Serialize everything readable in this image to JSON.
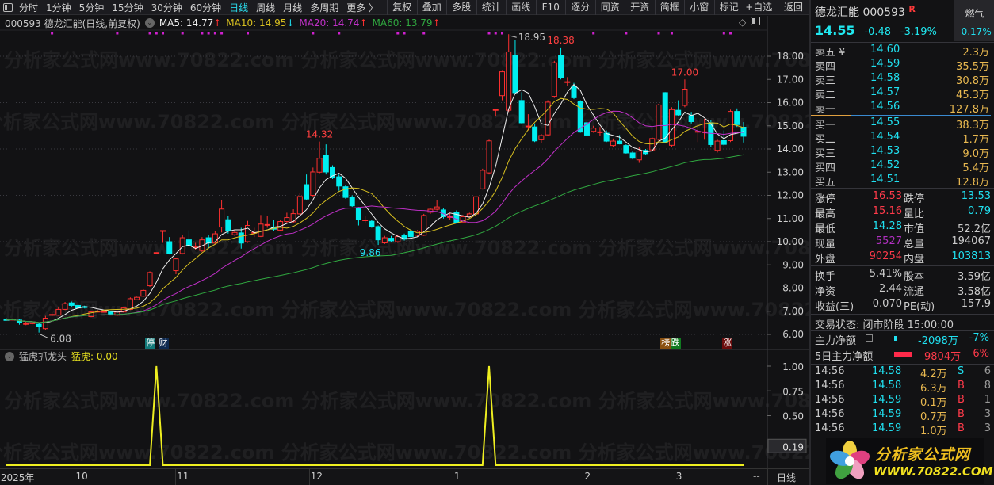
{
  "toolbar": {
    "periods": [
      "分时",
      "1分钟",
      "5分钟",
      "15分钟",
      "30分钟",
      "60分钟",
      "日线",
      "周线",
      "月线",
      "多周期",
      "更多 〉"
    ],
    "active_period": "日线",
    "buttons": [
      "复权",
      "叠加",
      "多股",
      "统计",
      "画线",
      "F10",
      "逐分",
      "同资",
      "开资",
      "简框",
      "小窗",
      "标记",
      "+自选"
    ],
    "back": "返回"
  },
  "header": {
    "title": "000593 德龙汇能(日线,前复权)",
    "ma5": "MA5: 14.77",
    "ma5_arrow": "↑",
    "ma10": "MA10: 14.95",
    "ma10_arrow": "↓",
    "ma20": "MA20: 14.74",
    "ma20_arrow": "↑",
    "ma60": "MA60: 13.79",
    "ma60_arrow": "↑",
    "diamond": "◇"
  },
  "watermark": "分析家公式网www.70822.com",
  "badges": [
    {
      "text": "停",
      "bg": "#137a7a",
      "at_index": 22
    },
    {
      "text": "财",
      "bg": "#0f2a50",
      "at_index": 24
    },
    {
      "text": "榜",
      "bg": "#8a5010",
      "at_index": 101
    },
    {
      "text": "跌",
      "bg": "#107a20",
      "at_index": 102.5
    },
    {
      "text": "涨",
      "bg": "#6a0c0c",
      "at_index": 110.5
    }
  ],
  "indicator": {
    "name": "猛虎抓龙头",
    "series_label": "猛虎:",
    "value": "0.00"
  },
  "colors": {
    "up": "#ff3030",
    "down": "#00eef0",
    "ma5": "#f0f0f0",
    "ma10": "#d8c020",
    "ma20": "#c030c8",
    "ma60": "#30a840",
    "indicator": "#eeee20",
    "marker": "#d020d0"
  },
  "chart_data": [
    {
      "type": "candlestick",
      "title": "000593 德龙汇能(日线,前复权)",
      "ylim": [
        6,
        18
      ],
      "yticks": [
        "18.00",
        "17.00",
        "16.00",
        "15.00",
        "14.00",
        "13.00",
        "12.00",
        "11.00",
        "10.00",
        "9.00",
        "8.00",
        "7.00",
        "6.00"
      ],
      "ma_periods": [
        5,
        10,
        20,
        60
      ],
      "ohlc": [
        [
          6.64,
          6.7,
          6.58,
          6.62
        ],
        [
          6.62,
          6.7,
          6.6,
          6.66
        ],
        [
          6.62,
          6.66,
          6.42,
          6.5
        ],
        [
          6.47,
          6.55,
          6.4,
          6.47
        ],
        [
          6.5,
          6.56,
          6.44,
          6.5
        ],
        [
          6.44,
          6.48,
          6.08,
          6.33
        ],
        [
          6.25,
          6.8,
          6.2,
          6.7
        ],
        [
          6.86,
          6.96,
          6.78,
          6.86
        ],
        [
          6.83,
          7.2,
          6.8,
          7.08
        ],
        [
          7.08,
          7.4,
          7.05,
          7.33
        ],
        [
          7.36,
          7.42,
          7.2,
          7.25
        ],
        [
          7.25,
          7.3,
          7.1,
          7.14
        ],
        [
          7.2,
          7.24,
          7.12,
          7.16
        ],
        [
          6.77,
          7.0,
          6.74,
          6.97
        ],
        [
          7.0,
          7.05,
          6.95,
          7.0
        ],
        [
          6.99,
          7.04,
          6.95,
          6.99
        ],
        [
          6.97,
          7.0,
          6.85,
          6.88
        ],
        [
          6.83,
          7.0,
          6.8,
          6.97
        ],
        [
          6.97,
          7.18,
          6.94,
          7.14
        ],
        [
          7.08,
          7.6,
          7.05,
          7.54
        ],
        [
          7.5,
          7.63,
          7.47,
          7.6
        ],
        [
          7.65,
          7.95,
          7.62,
          7.9
        ],
        [
          8.1,
          8.72,
          8.05,
          8.67
        ],
        [
          9.53,
          9.53,
          9.5,
          9.53
        ],
        [
          10.48,
          10.48,
          9.95,
          10.48
        ],
        [
          10.0,
          10.2,
          9.45,
          9.5
        ],
        [
          8.75,
          9.3,
          8.6,
          9.26
        ],
        [
          9.49,
          10.3,
          9.45,
          10.17
        ],
        [
          10.08,
          10.5,
          9.8,
          9.83
        ],
        [
          9.77,
          9.95,
          9.65,
          9.77
        ],
        [
          9.62,
          10.2,
          9.55,
          10.08
        ],
        [
          10.17,
          10.3,
          9.7,
          9.94
        ],
        [
          9.94,
          10.45,
          9.9,
          10.34
        ],
        [
          10.63,
          11.8,
          10.4,
          11.41
        ],
        [
          10.95,
          11.1,
          10.35,
          10.47
        ],
        [
          10.3,
          10.5,
          10.25,
          10.4
        ],
        [
          10.38,
          10.6,
          9.7,
          9.94
        ],
        [
          10.0,
          10.9,
          9.95,
          10.7
        ],
        [
          10.4,
          10.6,
          10.2,
          10.4
        ],
        [
          10.23,
          11.15,
          10.2,
          10.76
        ],
        [
          10.74,
          11.1,
          10.6,
          10.74
        ],
        [
          10.63,
          10.95,
          10.45,
          10.54
        ],
        [
          10.5,
          10.95,
          10.45,
          10.87
        ],
        [
          10.87,
          11.25,
          10.8,
          11.04
        ],
        [
          10.86,
          11.4,
          10.8,
          11.21
        ],
        [
          11.2,
          12.1,
          11.15,
          11.95
        ],
        [
          12.46,
          12.9,
          11.8,
          11.84
        ],
        [
          12.0,
          13.2,
          11.95,
          13.01
        ],
        [
          13.0,
          14.32,
          12.95,
          13.6
        ],
        [
          13.74,
          14.2,
          12.9,
          13.01
        ],
        [
          13.2,
          13.3,
          12.7,
          12.75
        ],
        [
          12.8,
          12.9,
          12.2,
          12.4
        ],
        [
          12.37,
          12.45,
          11.85,
          11.91
        ],
        [
          11.91,
          12.0,
          11.5,
          11.55
        ],
        [
          11.45,
          11.5,
          10.7,
          10.94
        ],
        [
          10.94,
          11.1,
          10.8,
          10.94
        ],
        [
          10.88,
          10.95,
          10.6,
          10.65
        ],
        [
          10.65,
          10.7,
          9.86,
          10.08
        ],
        [
          9.95,
          10.25,
          9.9,
          10.17
        ],
        [
          10.15,
          10.25,
          10.0,
          10.04
        ],
        [
          10.0,
          10.3,
          9.95,
          10.22
        ],
        [
          10.28,
          10.35,
          10.05,
          10.11
        ],
        [
          10.45,
          10.55,
          10.15,
          10.22
        ],
        [
          10.28,
          10.5,
          10.2,
          10.45
        ],
        [
          10.28,
          11.2,
          10.25,
          11.13
        ],
        [
          11.27,
          11.45,
          11.2,
          11.4
        ],
        [
          11.4,
          11.8,
          11.35,
          11.5
        ],
        [
          11.37,
          11.45,
          11.0,
          11.08
        ],
        [
          11.08,
          11.25,
          10.95,
          11.08
        ],
        [
          11.28,
          11.35,
          10.8,
          10.83
        ],
        [
          10.83,
          11.15,
          10.8,
          11.08
        ],
        [
          11.08,
          11.25,
          11.05,
          11.2
        ],
        [
          11.2,
          12.0,
          11.15,
          11.94
        ],
        [
          12.28,
          13.15,
          12.25,
          13.08
        ],
        [
          12.97,
          14.4,
          12.9,
          14.35
        ],
        [
          15.7,
          15.7,
          15.4,
          15.7
        ],
        [
          16.3,
          17.4,
          16.1,
          17.33
        ],
        [
          15.67,
          18.95,
          15.6,
          18.19
        ],
        [
          18.02,
          18.7,
          16.4,
          16.43
        ],
        [
          16.09,
          16.45,
          15.1,
          15.13
        ],
        [
          14.99,
          15.5,
          14.8,
          14.99
        ],
        [
          14.95,
          15.1,
          14.3,
          14.35
        ],
        [
          14.4,
          14.65,
          14.25,
          14.58
        ],
        [
          14.61,
          16.1,
          14.55,
          16.02
        ],
        [
          16.27,
          17.8,
          16.2,
          17.72
        ],
        [
          18.04,
          18.38,
          17.0,
          17.07
        ],
        [
          16.9,
          17.1,
          16.7,
          16.9
        ],
        [
          16.72,
          16.85,
          16.15,
          16.21
        ],
        [
          16.04,
          16.1,
          14.7,
          14.73
        ],
        [
          15.13,
          15.2,
          14.55,
          14.6
        ],
        [
          14.76,
          15.0,
          14.7,
          14.9
        ],
        [
          14.74,
          14.95,
          14.55,
          14.74
        ],
        [
          14.68,
          14.8,
          14.3,
          14.34
        ],
        [
          14.15,
          14.45,
          14.1,
          14.34
        ],
        [
          14.34,
          14.6,
          14.2,
          14.22
        ],
        [
          14.15,
          14.2,
          13.8,
          13.83
        ],
        [
          13.83,
          13.9,
          13.55,
          13.6
        ],
        [
          13.53,
          14.1,
          13.4,
          13.91
        ],
        [
          13.94,
          14.0,
          13.75,
          13.8
        ],
        [
          13.96,
          14.5,
          13.9,
          14.45
        ],
        [
          14.42,
          15.95,
          14.35,
          15.9
        ],
        [
          16.43,
          16.45,
          14.25,
          14.3
        ],
        [
          14.16,
          15.8,
          14.1,
          15.7
        ],
        [
          15.67,
          16.1,
          15.4,
          15.47
        ],
        [
          15.88,
          17.0,
          15.8,
          16.58
        ],
        [
          15.44,
          15.6,
          15.1,
          15.18
        ],
        [
          14.76,
          15.1,
          14.3,
          14.76
        ],
        [
          14.74,
          15.3,
          14.4,
          14.74
        ],
        [
          15.13,
          15.25,
          14.1,
          14.19
        ],
        [
          13.94,
          14.4,
          13.85,
          14.34
        ],
        [
          14.36,
          14.8,
          14.15,
          14.2
        ],
        [
          14.36,
          15.7,
          14.3,
          15.62
        ],
        [
          15.62,
          15.75,
          14.95,
          15.05
        ],
        [
          14.94,
          15.16,
          14.28,
          14.55
        ]
      ],
      "annotations": [
        {
          "text": "6.08",
          "at_index": 5,
          "price": 6.08,
          "kind": "low",
          "color": "#c8c8c8"
        },
        {
          "text": "14.32",
          "at_index": 48,
          "price": 14.32,
          "kind": "high",
          "color": "#ff4040"
        },
        {
          "text": "9.86",
          "at_index": 57,
          "price": 9.86,
          "kind": "low",
          "color": "#20e0f0"
        },
        {
          "text": "18.95",
          "at_index": 77,
          "price": 18.95,
          "kind": "high",
          "color": "#c8c8c8"
        },
        {
          "text": "18.38",
          "at_index": 85,
          "price": 18.38,
          "kind": "high",
          "color": "#ff4040"
        },
        {
          "text": "17.00",
          "at_index": 104,
          "price": 17.0,
          "kind": "high",
          "color": "#ff4040"
        }
      ],
      "marker_indices": [
        7,
        17,
        22,
        23,
        24,
        27,
        30,
        31,
        32,
        33,
        37,
        47,
        51,
        60,
        61,
        64,
        74,
        75,
        76,
        90,
        95,
        100,
        102,
        110,
        111
      ],
      "date_labels": [
        {
          "text": "2025年",
          "at_index": -0.5
        },
        {
          "text": "10",
          "at_index": 11
        },
        {
          "text": "11",
          "at_index": 26.5
        },
        {
          "text": "12",
          "at_index": 47
        },
        {
          "text": "1",
          "at_index": 69
        },
        {
          "text": "2",
          "at_index": 89
        },
        {
          "text": "3",
          "at_index": 103
        }
      ]
    },
    {
      "type": "line",
      "title": "猛虎抓龙头",
      "series_name": "猛虎",
      "ylim": [
        0,
        1
      ],
      "yticks": [
        "1.00",
        "0.75",
        "0.50"
      ],
      "last_value_label": "0.19",
      "signal_indices": [
        23,
        74
      ]
    }
  ],
  "date_axis": {
    "dash": "--",
    "period": "日线"
  },
  "quote": {
    "name_code": "德龙汇能 000593",
    "r_flag": "R",
    "sector": "燃气",
    "sector_change": "-0.17%",
    "price": "14.55",
    "change": "-0.48",
    "change_pct": "-3.19%",
    "asks": [
      {
        "label": "卖五 ¥",
        "price": "14.60",
        "vol": "2.3万"
      },
      {
        "label": "卖四",
        "price": "14.59",
        "vol": "35.5万"
      },
      {
        "label": "卖三",
        "price": "14.58",
        "vol": "30.8万"
      },
      {
        "label": "卖二",
        "price": "14.57",
        "vol": "45.3万"
      },
      {
        "label": "卖一",
        "price": "14.56",
        "vol": "127.8万"
      }
    ],
    "bids": [
      {
        "label": "买一",
        "price": "14.55",
        "vol": "38.3万"
      },
      {
        "label": "买二",
        "price": "14.54",
        "vol": "1.7万"
      },
      {
        "label": "买三",
        "price": "14.53",
        "vol": "9.0万"
      },
      {
        "label": "买四",
        "price": "14.52",
        "vol": "5.4万"
      },
      {
        "label": "买五",
        "price": "14.51",
        "vol": "12.8万"
      }
    ],
    "stats": [
      [
        {
          "k": "涨停",
          "v": "16.53",
          "c": "#ff3a4a"
        },
        {
          "k": "跌停",
          "v": "13.53",
          "c": "#20e0f0"
        }
      ],
      [
        {
          "k": "最高",
          "v": "15.16",
          "c": "#ff3a4a"
        },
        {
          "k": "量比",
          "v": "0.79",
          "c": "#20e0f0"
        }
      ],
      [
        {
          "k": "最低",
          "v": "14.28",
          "c": "#20e0f0"
        },
        {
          "k": "市值",
          "v": "52.2亿",
          "c": "#cccccc"
        }
      ],
      [
        {
          "k": "现量",
          "v": "5527",
          "c": "#b030c0"
        },
        {
          "k": "总量",
          "v": "194067",
          "c": "#cccccc"
        }
      ],
      [
        {
          "k": "外盘",
          "v": "90254",
          "c": "#ff3a4a"
        },
        {
          "k": "内盘",
          "v": "103813",
          "c": "#20e0f0"
        }
      ]
    ],
    "stats2": [
      [
        {
          "k": "换手",
          "v": "5.41%",
          "c": "#cccccc"
        },
        {
          "k": "股本",
          "v": "3.59亿",
          "c": "#cccccc"
        }
      ],
      [
        {
          "k": "净资",
          "v": "2.44",
          "c": "#cccccc"
        },
        {
          "k": "流通",
          "v": "3.58亿",
          "c": "#cccccc"
        }
      ],
      [
        {
          "k": "收益(三)",
          "v": "0.070",
          "c": "#cccccc"
        },
        {
          "k": "PE(动)",
          "v": "157.9",
          "c": "#cccccc"
        }
      ]
    ],
    "trade_status": "交易状态: 闭市阶段 15:00:00",
    "main_net": {
      "label": "主力净额",
      "value": "-2098万",
      "pct": "-7%"
    },
    "main_net_5d": {
      "label": "5日主力净额",
      "value": "9804万",
      "pct": "6%"
    },
    "ticks": [
      {
        "time": "14:56",
        "price": "14.58",
        "vol": "4.2万",
        "side": "S",
        "n": "6"
      },
      {
        "time": "14:56",
        "price": "14.58",
        "vol": "6.3万",
        "side": "B",
        "n": "8"
      },
      {
        "time": "14:56",
        "price": "14.59",
        "vol": "0.1万",
        "side": "B",
        "n": "1"
      },
      {
        "time": "14:56",
        "price": "14.59",
        "vol": "0.7万",
        "side": "B",
        "n": "3"
      },
      {
        "time": "14:56",
        "price": "14.59",
        "vol": "1.0万",
        "side": "B",
        "n": "3"
      }
    ]
  },
  "logo": {
    "cn": "分析家公式网",
    "url": "WWW.70822.COM"
  }
}
